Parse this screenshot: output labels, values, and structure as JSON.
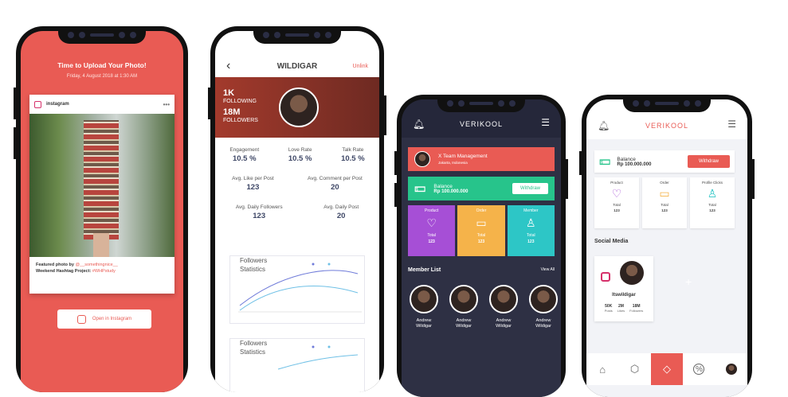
{
  "phone1": {
    "title": "Time to Upload Your Photo!",
    "date": "Friday, 4 August 2018 at 1:30 AM",
    "ig_label": "instagram",
    "more": "•••",
    "caption_line1_prefix": "Featured photo by ",
    "caption_user": "@__somethingnice__",
    "caption_line2_prefix": "Weekend Hashtag Project: ",
    "caption_tag": "#WHPstudy",
    "open_button": "Open in Instagram"
  },
  "phone2": {
    "back": "‹",
    "title": "WILDIGAR",
    "unlink": "Unlink",
    "following_count": "1K",
    "following_label": "FOLLOWING",
    "followers_count": "18M",
    "followers_label": "FOLLOWERS",
    "stats_row1": [
      {
        "label": "Engagement",
        "value": "10.5 %"
      },
      {
        "label": "Love Rate",
        "value": "10.5 %"
      },
      {
        "label": "Talk Rate",
        "value": "10.5 %"
      }
    ],
    "stats_row2": [
      {
        "label": "Avg. Like per Post",
        "value": "123"
      },
      {
        "label": "Avg. Comment per Post",
        "value": "20"
      }
    ],
    "stats_row3": [
      {
        "label": "Avg. Daily Followers",
        "value": "123"
      },
      {
        "label": "Avg. Daily Post",
        "value": "20"
      }
    ],
    "chart1_title_a": "Followers",
    "chart1_title_b": "Statistics",
    "chart2_title_a": "Followers",
    "chart2_title_b": "Statistics"
  },
  "phone3": {
    "brand": "VERIKOOL",
    "team_name": "X Team Management",
    "team_location": "Jakarta, Indonesia",
    "balance_label": "Balance",
    "balance_value": "Rp 100.000.000",
    "withdraw": "Withdraw",
    "tiles": [
      {
        "label": "Product",
        "total_label": "Total",
        "total": "123",
        "color": "#a64fd6"
      },
      {
        "label": "Order",
        "total_label": "Total",
        "total": "123",
        "color": "#f5b34a"
      },
      {
        "label": "Member",
        "total_label": "Total",
        "total": "123",
        "color": "#2dc6c6"
      }
    ],
    "member_list": "Member List",
    "view_all": "View All",
    "members": [
      {
        "first": "Andrew",
        "last": "Wildigar"
      },
      {
        "first": "Andrew",
        "last": "Wildigar"
      },
      {
        "first": "Andrew",
        "last": "Wildigar"
      },
      {
        "first": "Andrew",
        "last": "Wildigar"
      }
    ]
  },
  "phone4": {
    "brand": "VERIKOOL",
    "balance_label": "Balance",
    "balance_value": "Rp 100.000.000",
    "withdraw": "Withdraw",
    "cards": [
      {
        "label": "Product",
        "total_label": "Total",
        "total": "123",
        "color": "#a64fd6"
      },
      {
        "label": "Order",
        "total_label": "Total",
        "total": "123",
        "color": "#f5b34a"
      },
      {
        "label": "Profile Clicks",
        "total_label": "Total",
        "total": "123",
        "color": "#2dc6c6"
      }
    ],
    "social_media": "Social Media",
    "username": "Itswildigar",
    "stats": [
      {
        "value": "50K",
        "label": "Posts"
      },
      {
        "value": "2M",
        "label": "Likes"
      },
      {
        "value": "18M",
        "label": "Followers"
      }
    ],
    "plus": "+"
  },
  "colors": {
    "accent": "#e95b54",
    "green": "#27c48b",
    "dark": "#2e3044"
  }
}
